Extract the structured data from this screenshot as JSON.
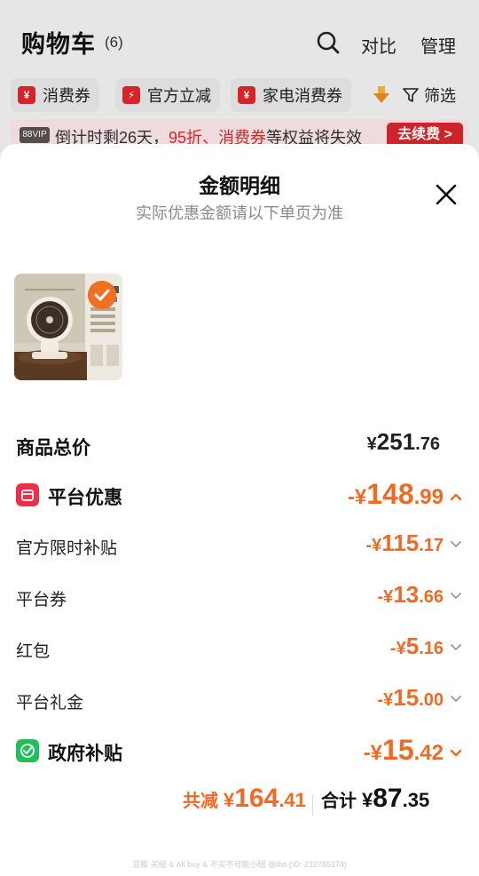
{
  "cart": {
    "title": "购物车",
    "count": "(6)",
    "actions": [
      "对比",
      "管理"
    ]
  },
  "chips": [
    {
      "icon": "coupon-icon",
      "label": "消费券"
    },
    {
      "icon": "lightning-icon",
      "label": "官方立减"
    },
    {
      "icon": "coupon-icon",
      "label": "家电消费券"
    }
  ],
  "filter": {
    "label": "筛选"
  },
  "vip_banner": {
    "badge": "88VIP",
    "text_prefix": "倒计时剩26天，",
    "highlight_1": "95折",
    "sep": "、",
    "highlight_2": "消费券",
    "text_suffix": "等权益将失效",
    "button": "去续费 >"
  },
  "sheet": {
    "title": "金额明细",
    "subtitle": "实际优惠金额请以下单页为准"
  },
  "breakdown": {
    "total_price": {
      "label": "商品总价",
      "sym": "¥",
      "int": "251",
      "dec": ".76"
    },
    "platform_discount": {
      "label": "平台优惠",
      "sym": "-¥",
      "int": "148",
      "dec": ".99"
    },
    "official_subsidy": {
      "label": "官方限时补贴",
      "sym": "-¥",
      "int": "115",
      "dec": ".17"
    },
    "platform_coupon": {
      "label": "平台券",
      "sym": "-¥",
      "int": "13",
      "dec": ".66"
    },
    "red_packet": {
      "label": "红包",
      "sym": "-¥",
      "int": "5",
      "dec": ".16"
    },
    "platform_gift": {
      "label": "平台礼金",
      "sym": "-¥",
      "int": "15",
      "dec": ".00"
    },
    "gov_subsidy": {
      "label": "政府补贴",
      "sym": "-¥",
      "int": "15",
      "dec": ".42"
    }
  },
  "totals": {
    "saved_label": "共减",
    "saved_sym": "¥",
    "saved_int": "164",
    "saved_dec": ".41",
    "total_label": "合计",
    "total_sym": "¥",
    "total_int": "87",
    "total_dec": ".35"
  },
  "colors": {
    "accent_orange": "#f06a24",
    "brand_red": "#e0282e",
    "gov_green": "#1fbf5a"
  },
  "footer_note": "豆瓣 买组 & All buy & 不买不可能小组 @tbs (ID: 232785174)"
}
